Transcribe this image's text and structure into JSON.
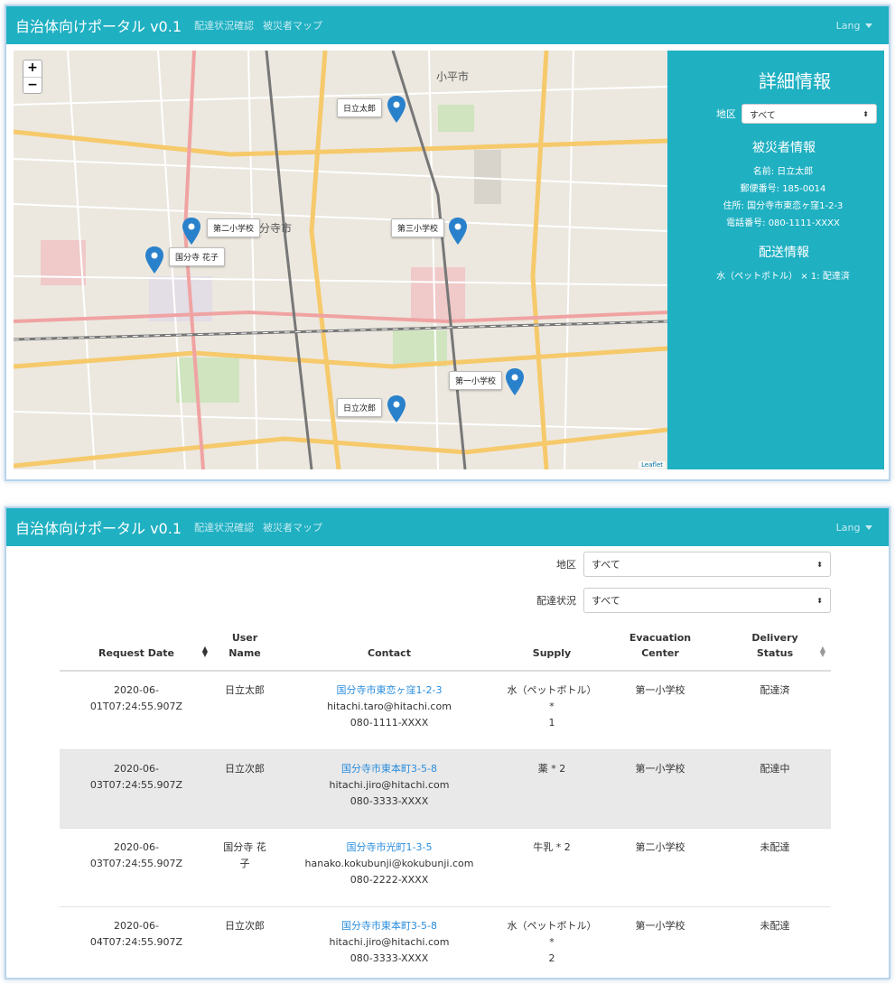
{
  "nav": {
    "brand": "自治体向けポータル v0.1",
    "links": [
      "配達状況確認",
      "被災者マップ"
    ],
    "lang": "Lang"
  },
  "map": {
    "zoom_in": "+",
    "zoom_out": "−",
    "attribution": "Leaflet",
    "place_labels": {
      "kodaira": "小平市",
      "kokubunji": "分寺市"
    },
    "markers": [
      {
        "label": "日立太郎"
      },
      {
        "label": "第二小学校"
      },
      {
        "label": "国分寺 花子"
      },
      {
        "label": "第三小学校"
      },
      {
        "label": "第一小学校"
      },
      {
        "label": "日立次郎"
      }
    ]
  },
  "detail": {
    "title": "詳細情報",
    "district_label": "地区",
    "district_value": "すべて",
    "victim_heading": "被災者情報",
    "name": "名前: 日立太郎",
    "postal": "郵便番号: 185-0014",
    "address": "住所: 国分寺市東恋ヶ窪1-2-3",
    "phone": "電話番号: 080-1111-XXXX",
    "delivery_heading": "配送情報",
    "delivery_line": "水（ペットボトル） × 1: 配達済"
  },
  "filters": {
    "district_label": "地区",
    "district_value": "すべて",
    "status_label": "配達状況",
    "status_value": "すべて"
  },
  "table": {
    "headers": {
      "request_date": "Request Date",
      "user_name_1": "User",
      "user_name_2": "Name",
      "contact": "Contact",
      "supply": "Supply",
      "evac_1": "Evacuation",
      "evac_2": "Center",
      "status_1": "Delivery",
      "status_2": "Status"
    },
    "rows": [
      {
        "date_1": "2020-06-",
        "date_2": "01T07:24:55.907Z",
        "user_1": "日立太郎",
        "user_2": "",
        "address": "国分寺市東恋ヶ窪1-2-3",
        "email": "hitachi.taro@hitachi.com",
        "phone": "080-1111-XXXX",
        "supply_1": "水（ペットボトル） *",
        "supply_2": "1",
        "center": "第一小学校",
        "status": "配達済"
      },
      {
        "date_1": "2020-06-",
        "date_2": "03T07:24:55.907Z",
        "user_1": "日立次郎",
        "user_2": "",
        "address": "国分寺市東本町3-5-8",
        "email": "hitachi.jiro@hitachi.com",
        "phone": "080-3333-XXXX",
        "supply_1": "薬 * 2",
        "supply_2": "",
        "center": "第一小学校",
        "status": "配達中"
      },
      {
        "date_1": "2020-06-",
        "date_2": "03T07:24:55.907Z",
        "user_1": "国分寺 花",
        "user_2": "子",
        "address": "国分寺市光町1-3-5",
        "email": "hanako.kokubunji@kokubunji.com",
        "phone": "080-2222-XXXX",
        "supply_1": "牛乳 * 2",
        "supply_2": "",
        "center": "第二小学校",
        "status": "未配達"
      },
      {
        "date_1": "2020-06-",
        "date_2": "04T07:24:55.907Z",
        "user_1": "日立次郎",
        "user_2": "",
        "address": "国分寺市東本町3-5-8",
        "email": "hitachi.jiro@hitachi.com",
        "phone": "080-3333-XXXX",
        "supply_1": "水（ペットボトル） *",
        "supply_2": "2",
        "center": "第一小学校",
        "status": "未配達"
      }
    ]
  },
  "colors": {
    "navbar": "#1fb0c2",
    "marker": "#2a81cb",
    "link": "#2a8ddd",
    "shaded_row": "#e9e9e9"
  }
}
